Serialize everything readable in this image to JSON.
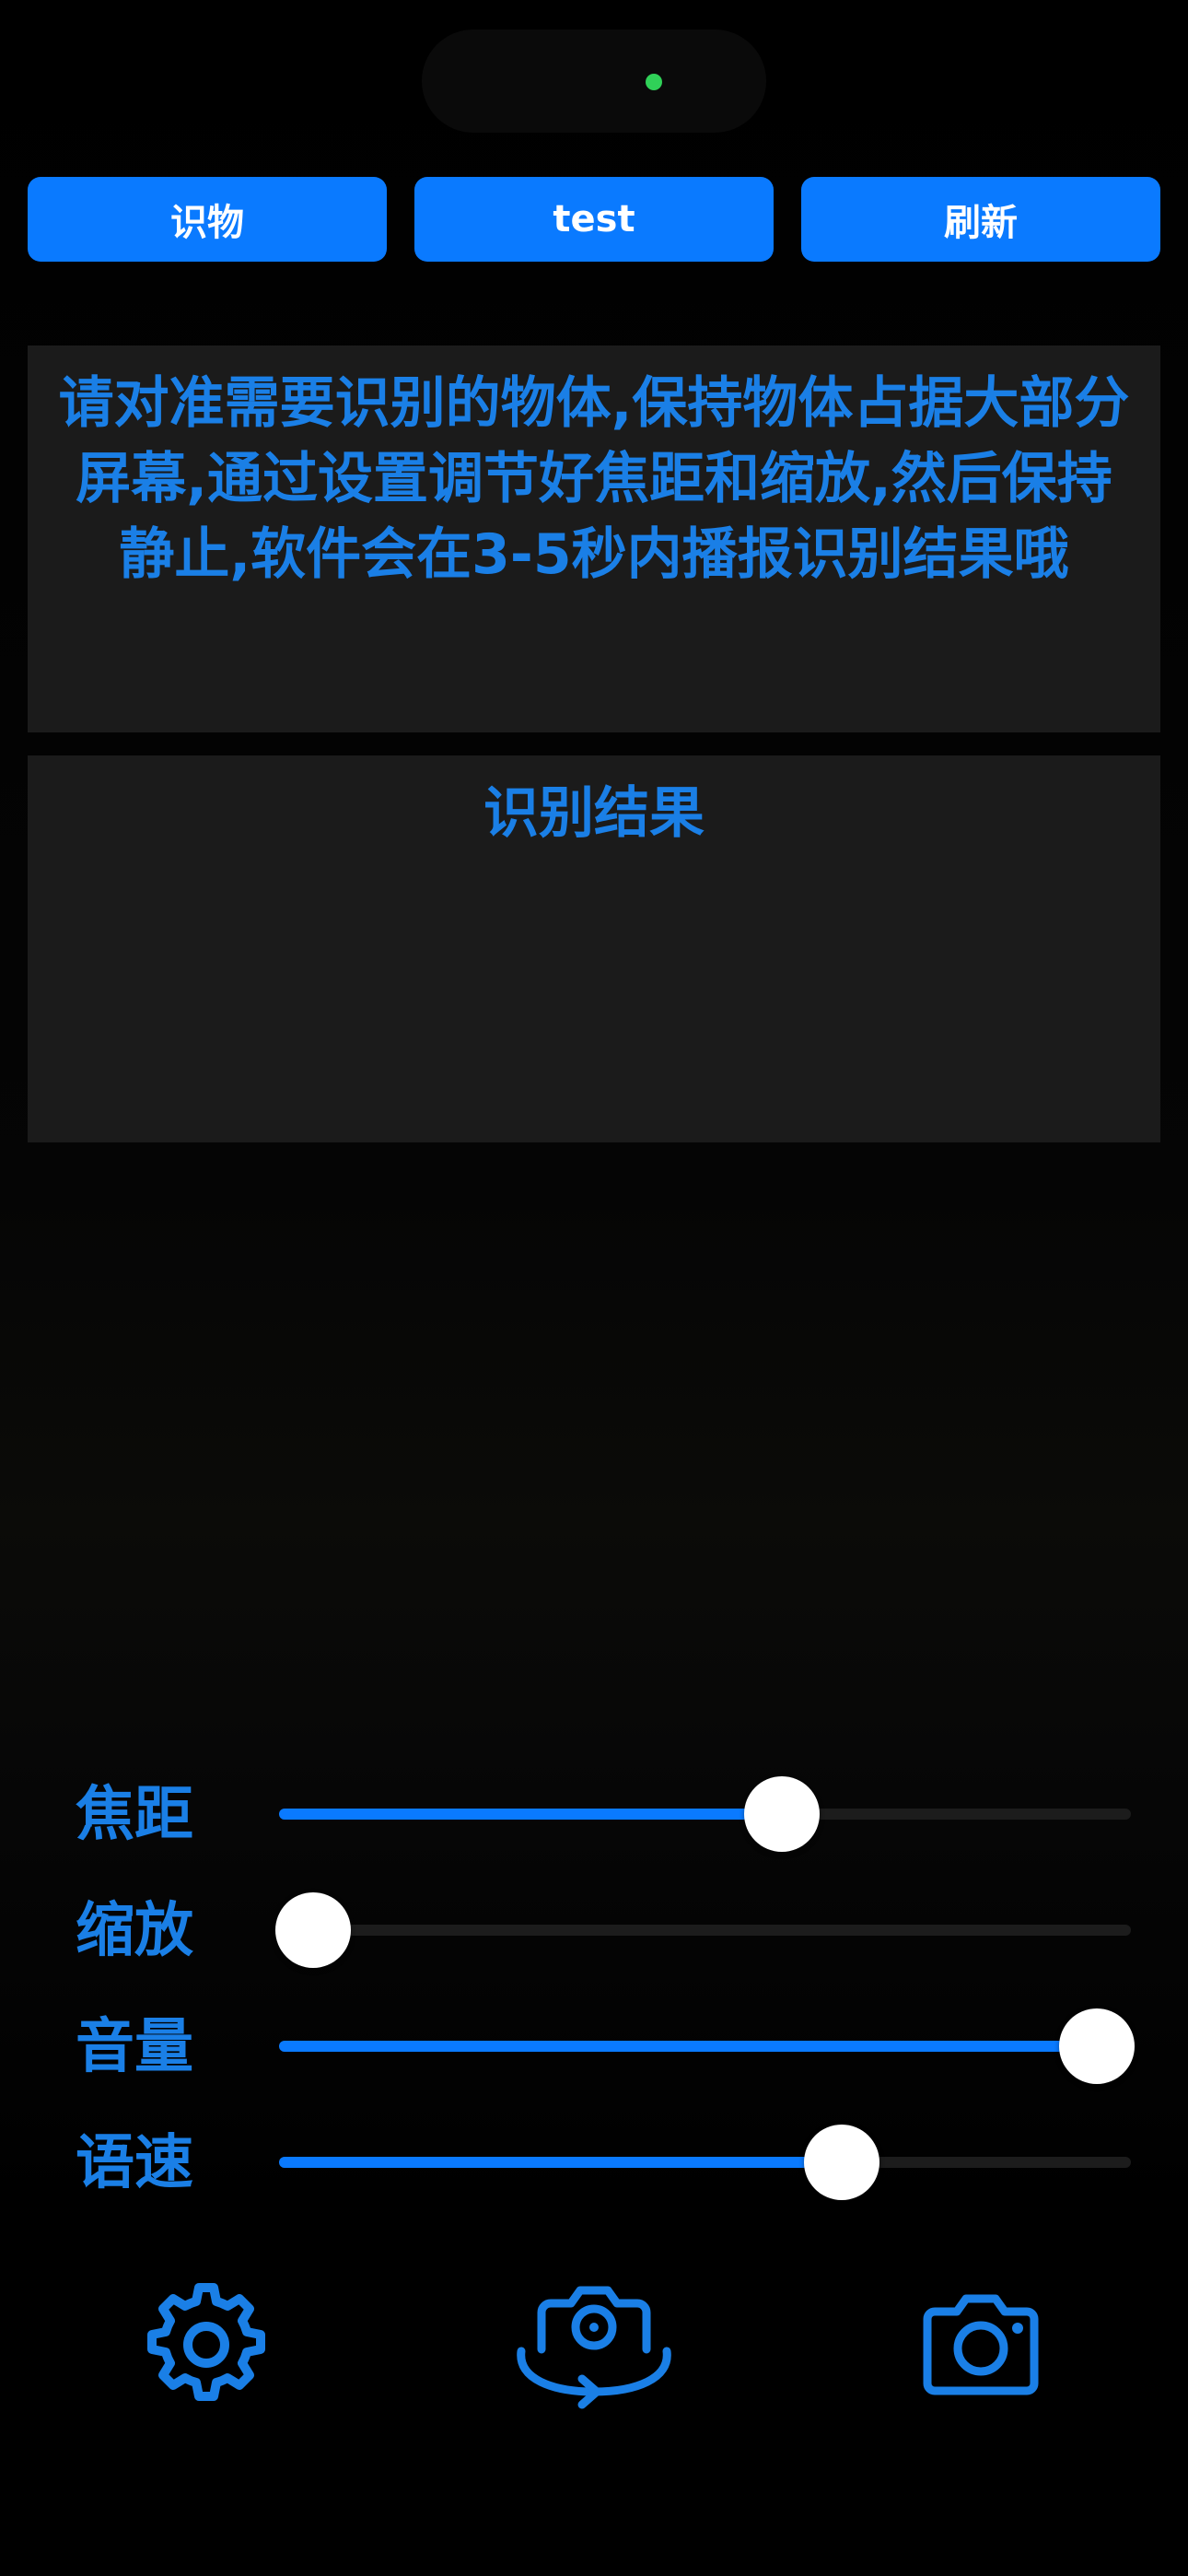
{
  "status_bar": {
    "camera_indicator_color": "#30d158"
  },
  "top_buttons": {
    "recognize": "识物",
    "test": "test",
    "refresh": "刷新"
  },
  "instructions": "请对准需要识别的物体,保持物体占据大部分屏幕,通过设置调节好焦距和缩放,然后保持静止,软件会在3-5秒内播报识别结果哦",
  "result": {
    "title": "识别结果"
  },
  "sliders": [
    {
      "label": "焦距",
      "value": 0.59
    },
    {
      "label": "缩放",
      "value": 0.04
    },
    {
      "label": "音量",
      "value": 0.96
    },
    {
      "label": "语速",
      "value": 0.66
    }
  ],
  "bottom_bar": {
    "icons": [
      "gear-icon",
      "switch-camera-icon",
      "camera-icon"
    ]
  },
  "colors": {
    "accent": "#0a7aff",
    "text_blue": "#1a7fe6",
    "panel_bg": "#1b1b1b",
    "track_bg": "#1c1c1c"
  }
}
